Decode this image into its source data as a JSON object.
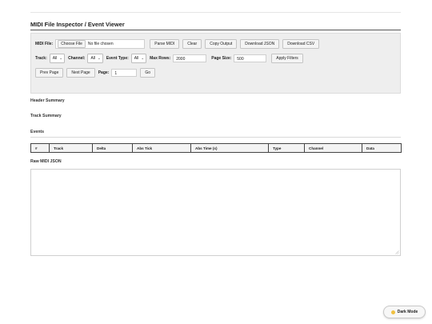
{
  "page": {
    "title": "MIDI File Inspector / Event Viewer"
  },
  "controls": {
    "midi_file_label": "MIDI File:",
    "choose_file_label": "Choose File",
    "no_file_text": "No file chosen",
    "parse_label": "Parse MIDI",
    "clear_label": "Clear",
    "copy_label": "Copy Output",
    "download_json_label": "Download JSON",
    "download_csv_label": "Download CSV",
    "track_label": "Track:",
    "track_value": "All",
    "channel_label": "Channel:",
    "channel_value": "All",
    "event_type_label": "Event Type:",
    "event_type_value": "All",
    "max_rows_label": "Max Rows:",
    "max_rows_value": "2000",
    "page_size_label": "Page Size:",
    "page_size_value": "500",
    "apply_label": "Apply Filters",
    "prev_label": "Prev Page",
    "next_label": "Next Page",
    "page_label": "Page:",
    "page_value": "1",
    "go_label": "Go"
  },
  "sections": {
    "header_summary": "Header Summary",
    "track_summary": "Track Summary",
    "events": "Events",
    "raw_json": "Raw MIDI JSON"
  },
  "events_table": {
    "columns": [
      "#",
      "Track",
      "Delta",
      "Abs Tick",
      "Abs Time (s)",
      "Type",
      "Channel",
      "Data"
    ]
  },
  "dark_mode": {
    "label": "Dark Mode",
    "icon": "moon-icon"
  }
}
